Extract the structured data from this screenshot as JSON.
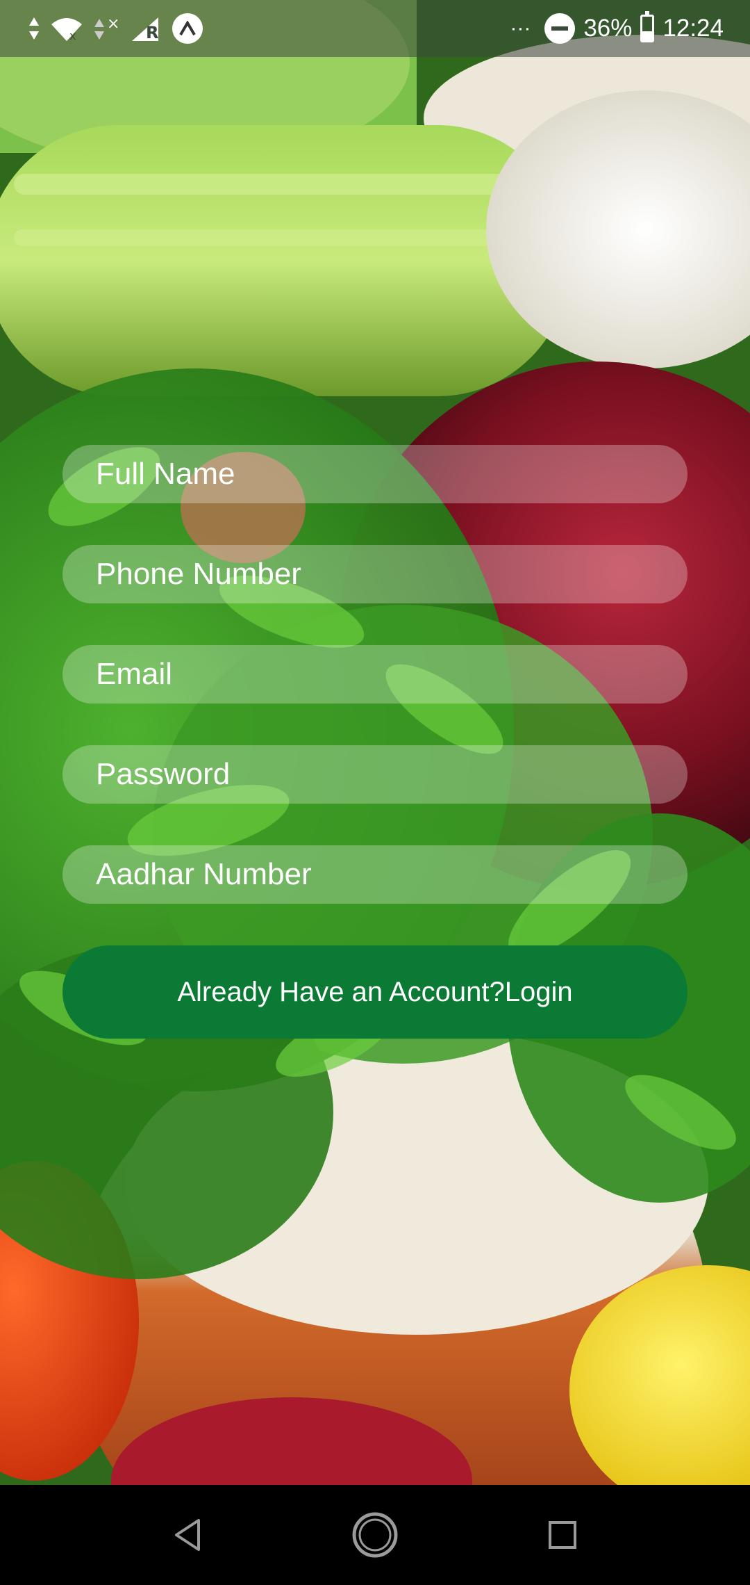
{
  "status_bar": {
    "battery_percent": "36%",
    "time": "12:24",
    "overflow": "···",
    "carrier_badge": "R",
    "icons": [
      "signal-arrows-icon",
      "wifi-icon",
      "no-signal-icon",
      "cellular-icon",
      "assistant-icon",
      "do-not-disturb-icon",
      "battery-icon"
    ]
  },
  "form": {
    "fields": [
      {
        "placeholder": "Full Name",
        "value": ""
      },
      {
        "placeholder": "Phone Number",
        "value": ""
      },
      {
        "placeholder": "Email",
        "value": ""
      },
      {
        "placeholder": "Password",
        "value": ""
      },
      {
        "placeholder": "Aadhar Number",
        "value": ""
      }
    ],
    "login_button_label": "Already Have an Account?Login"
  },
  "colors": {
    "button_green": "#0b7a35",
    "field_fill": "rgba(255,255,255,0.28)",
    "text": "#ffffff"
  },
  "nav_bar": {
    "icons": [
      "back-icon",
      "home-icon",
      "recents-icon"
    ]
  }
}
